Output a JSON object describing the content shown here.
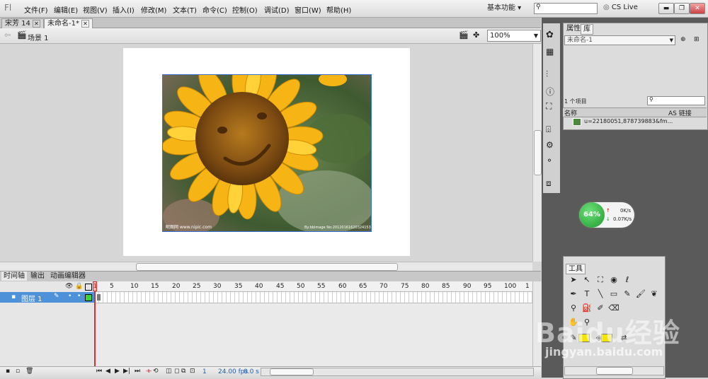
{
  "app": {
    "logo": "Fl"
  },
  "menu": [
    "文件(F)",
    "编辑(E)",
    "视图(V)",
    "插入(I)",
    "修改(M)",
    "文本(T)",
    "命令(C)",
    "控制(O)",
    "调试(D)",
    "窗口(W)",
    "帮助(H)"
  ],
  "workspace": "基本功能 ▾",
  "cs_live": "CS Live",
  "doc_tabs": [
    {
      "label": "宋芳  14"
    },
    {
      "label": "未命名-1*"
    }
  ],
  "scene": "场景 1",
  "zoom": "100%",
  "photo": {
    "watermark_left": "昵图网 www.nipic.com",
    "watermark_right": "By:bbimage No:20120161620324153"
  },
  "timeline": {
    "tabs": [
      "时间轴",
      "输出",
      "动画编辑器"
    ],
    "layer_name": "图层 1",
    "ruler": [
      "5",
      "10",
      "15",
      "20",
      "25",
      "30",
      "35",
      "40",
      "45",
      "50",
      "55",
      "60",
      "65",
      "70",
      "75",
      "80",
      "85",
      "90",
      "95",
      "100",
      "1"
    ],
    "first_frame": "1",
    "status": {
      "frame": "1",
      "fps": "24.00 fps",
      "time": "0.0 s"
    }
  },
  "library": {
    "tabs": [
      "属性",
      "库"
    ],
    "doc_select": "未命名-1",
    "count": "1 个项目",
    "col_name": "名称",
    "col_link": "AS 链接",
    "item": "u=22180051,878739883&fm..."
  },
  "net_gauge": {
    "percent": "64%",
    "up": "0K/s",
    "down": "0.07K/s"
  },
  "tools_panel": {
    "title": "工具"
  },
  "watermark": {
    "brand": "Baidu经验",
    "url": "jingyan.baidu.com"
  }
}
